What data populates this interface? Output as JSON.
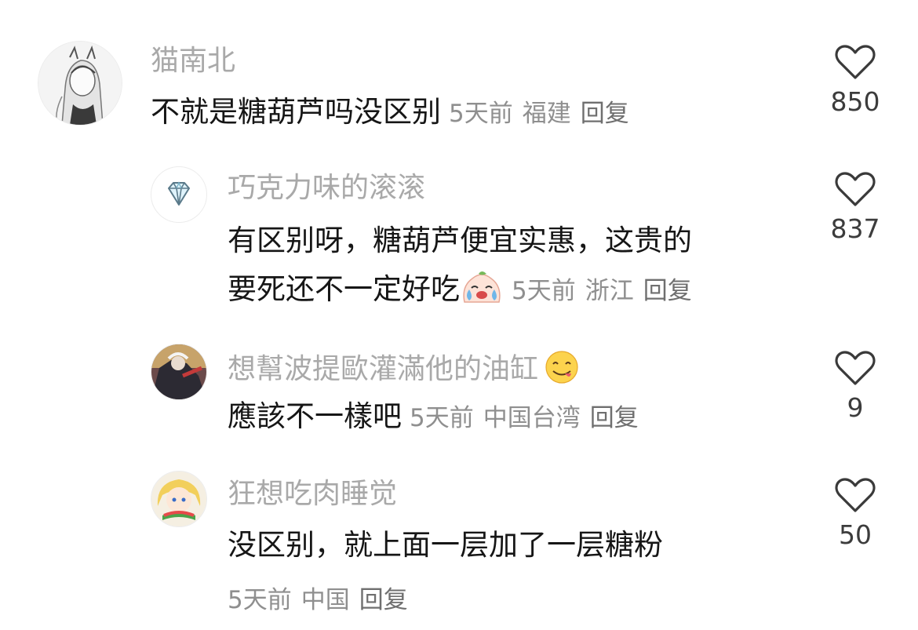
{
  "comments": [
    {
      "avatar": "avatar-anime-girl-sketch",
      "name": "猫南北",
      "text": "不就是糖葫芦吗没区别",
      "time": "5天前",
      "location": "福建",
      "reply": "回复",
      "likes": "850"
    },
    {
      "avatar": "diamond-icon",
      "name": "巧克力味的滚滚",
      "text_line1": "有区别呀，糖葫芦便宜实惠，这贵的",
      "text_line2": "要死还不一定好吃",
      "emoji": "crying-bun-emoji",
      "time": "5天前",
      "location": "浙江",
      "reply": "回复",
      "likes": "837"
    },
    {
      "avatar": "avatar-game-character",
      "name": "想幫波提歐灌滿他的油缸",
      "name_emoji": "yum-face-emoji",
      "text": "應該不一樣吧",
      "time": "5天前",
      "location": "中国台湾",
      "reply": "回复",
      "likes": "9"
    },
    {
      "avatar": "avatar-anime-girl-watermelon",
      "name": "狂想吃肉睡觉",
      "text": "没区别，就上面一层加了一层糖粉",
      "time": "5天前",
      "location": "中国",
      "reply": "回复",
      "likes": "50"
    }
  ],
  "colors": {
    "name": "#a9a9a9",
    "meta": "#8f8f8f",
    "text": "#161616"
  },
  "icons": {
    "like": "heart-outline-icon"
  }
}
